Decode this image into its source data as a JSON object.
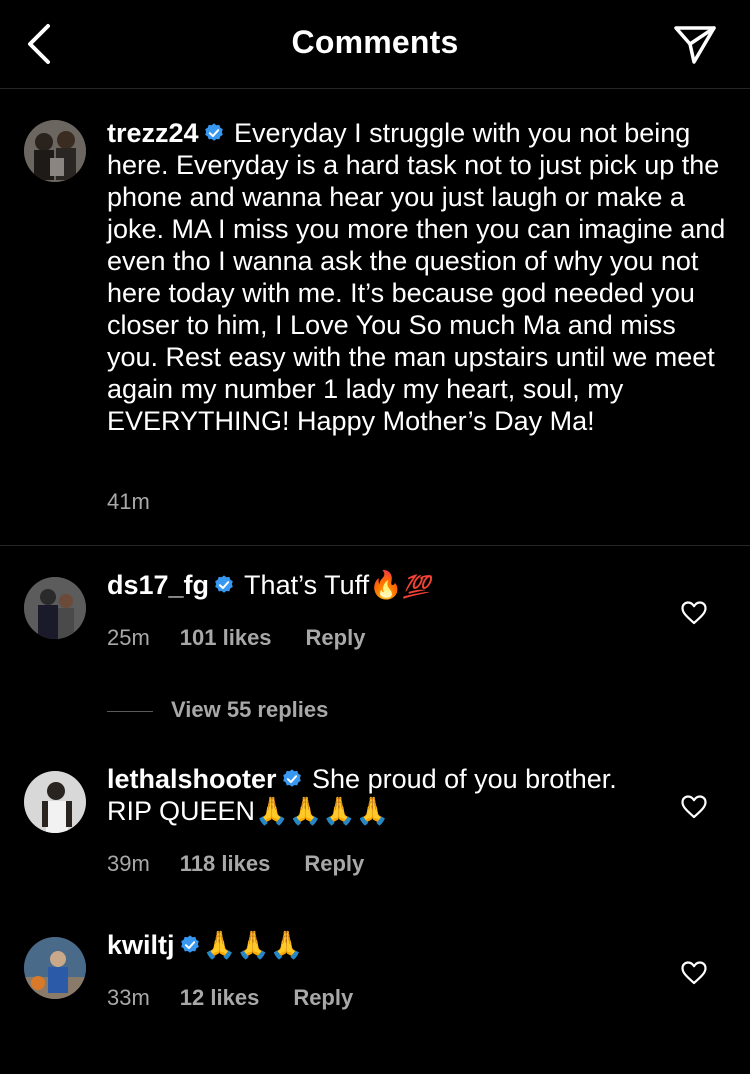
{
  "header": {
    "title": "Comments"
  },
  "caption": {
    "username": "trezz24",
    "text": "Everyday I struggle with you not being here. Everyday is a hard task not to just pick up the phone and wanna hear you just laugh or make a joke. MA I miss you more then you can imagine and even tho I wanna ask the question of why you not here today with me. It’s because god needed you closer to him, I Love You So much Ma and miss you. Rest easy with the man upstairs until we meet again my number 1 lady my heart, soul, my EVERYTHING! Happy Mother’s Day Ma!",
    "time": "41m"
  },
  "comments": [
    {
      "username": "ds17_fg",
      "text": "That’s Tuff",
      "emoji_1": "🔥",
      "emoji_2": "💯",
      "time": "25m",
      "likes": "101 likes",
      "reply": "Reply"
    },
    {
      "username": "lethalshooter",
      "text": "She proud of you brother. RIP QUEEN",
      "emoji": "🙏🙏🙏🙏",
      "time": "39m",
      "likes": "118 likes",
      "reply": "Reply"
    },
    {
      "username": "kwiltj",
      "text": "",
      "emoji": "🙏🙏🙏",
      "time": "33m",
      "likes": "12 likes",
      "reply": "Reply"
    }
  ],
  "view_replies": "View 55 replies",
  "colors": {
    "background": "#000000",
    "text": "#ffffff",
    "muted": "#a8a8a8",
    "verified": "#3897f0",
    "divider": "#262626"
  },
  "icons": {
    "back": "chevron-left-icon",
    "send": "paper-plane-icon",
    "verified": "verified-badge-icon",
    "heart": "heart-outline-icon"
  }
}
